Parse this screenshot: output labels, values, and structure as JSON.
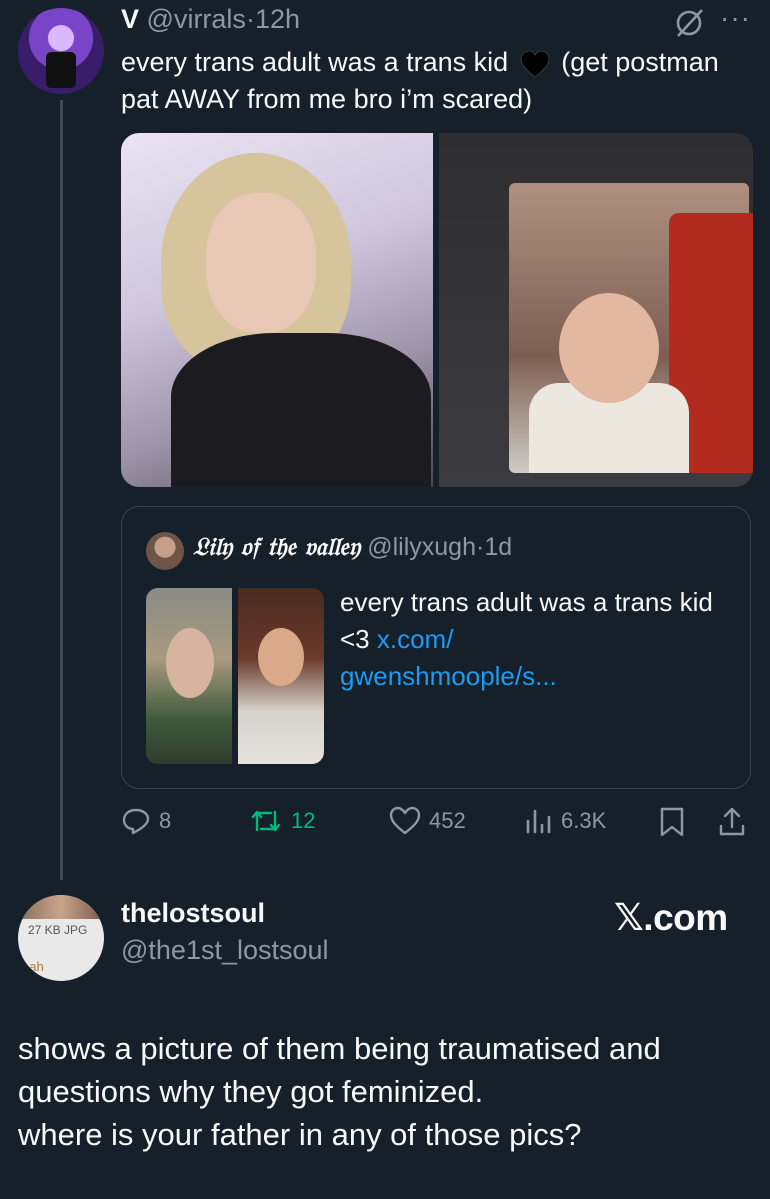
{
  "tweet": {
    "display_name": "V",
    "handle": "@virrals",
    "separator": "·",
    "time": "12h",
    "text_before_emoji": "every trans adult was a trans kid",
    "emoji": "black-heart",
    "text_after_emoji": "(get postman pat AWAY from me bro i’m scared)"
  },
  "quote": {
    "display_name": "𝔏𝔦𝔩𝔶 𝔬𝔣 𝔱𝔥𝔢 𝔳𝔞𝔩𝔩𝔢𝔶",
    "handle": "@lilyxugh",
    "separator": "·",
    "time": "1d",
    "text": "every trans adult was a trans kid <3 ",
    "link_part1": "x.com/",
    "link_part2": "gwenshmoople/s..."
  },
  "actions": {
    "replies": "8",
    "reposts": "12",
    "likes": "452",
    "views": "6.3K",
    "reply_color": "#8b98a5",
    "repost_color": "#00ba7c"
  },
  "reply": {
    "display_name": "thelostsoul",
    "handle": "@the1st_lostsoul",
    "avatar_badge": "27 KB JPG",
    "avatar_fragment": "eah",
    "brand": "𝕏.com",
    "text": "shows a picture of them being traumatised and\nquestions why they got feminized.\nwhere is your father in any of those pics?"
  },
  "colors": {
    "background": "#15202b",
    "text": "#f7f9f9",
    "muted": "#8b98a5",
    "link": "#1d9bf0",
    "border": "#38444d"
  }
}
